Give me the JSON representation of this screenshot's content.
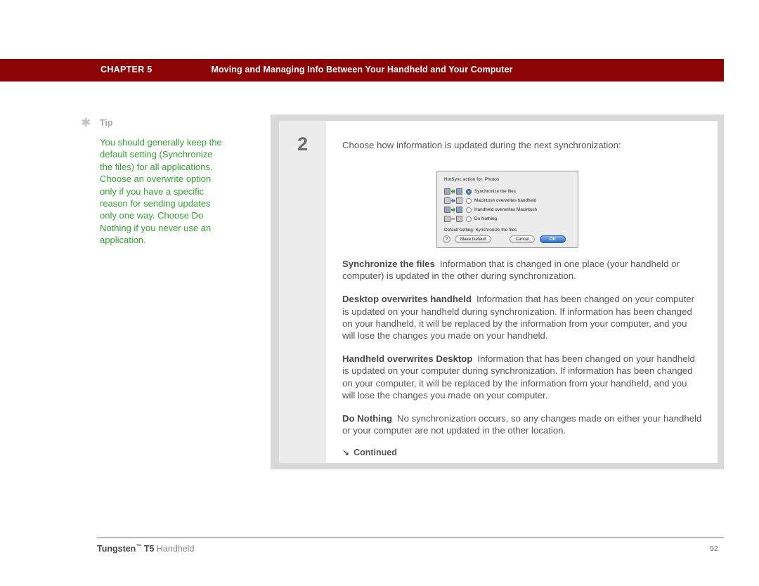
{
  "header": {
    "chapter_label": "CHAPTER 5",
    "running_title": "Moving and Managing Info Between Your Handheld and Your Computer",
    "bar_color": "#8c0404"
  },
  "tip": {
    "icon": "asterisk-icon",
    "title": "Tip",
    "body": "You should generally keep the default setting (Synchronize the files) for all applications. Choose an overwrite option only if you have a specific reason for sending updates only one way. Choose Do Nothing if you never use an application.",
    "text_color": "#33a532"
  },
  "step": {
    "number": "2",
    "intro": "Choose how information is updated during the next synchronization:"
  },
  "dialog": {
    "title": "HotSync action for:   Photos",
    "options": [
      {
        "label": "Synchronize the files",
        "selected": true,
        "icon": "sync-both-icon"
      },
      {
        "label": "Macintosh overwrites handheld",
        "selected": false,
        "icon": "sync-left-to-right-icon"
      },
      {
        "label": "Handheld overwrites Macintosh",
        "selected": false,
        "icon": "sync-right-to-left-icon"
      },
      {
        "label": "Do Nothing",
        "selected": false,
        "icon": "sync-none-icon"
      }
    ],
    "default_setting": "Default setting:  Synchronize the files",
    "buttons": {
      "help": "?",
      "make_default": "Make Default",
      "cancel": "Cancel",
      "ok": "OK"
    }
  },
  "definitions": [
    {
      "term": "Synchronize the files",
      "text": "Information that is changed in one place (your handheld or computer) is updated in the other during synchronization."
    },
    {
      "term": "Desktop overwrites handheld",
      "text": "Information that has been changed on your computer is updated on your handheld during synchronization. If information has been changed on your handheld, it will be replaced by the information from your computer, and you will lose the changes you made on your handheld."
    },
    {
      "term": "Handheld overwrites Desktop",
      "text": "Information that has been changed on your handheld is updated on your computer during synchronization. If information has been changed on your computer, it will be replaced by the information from your handheld, and you will lose the changes you made on your computer."
    },
    {
      "term": "Do Nothing",
      "text": "No synchronization occurs, so any changes made on either your handheld or your computer are not updated in the other location."
    }
  ],
  "continued": {
    "arrow": "↘",
    "label": "Continued"
  },
  "footer": {
    "brand": "Tungsten",
    "tm": "™",
    "model": "T5",
    "product": "Handheld",
    "page_number": "92"
  }
}
